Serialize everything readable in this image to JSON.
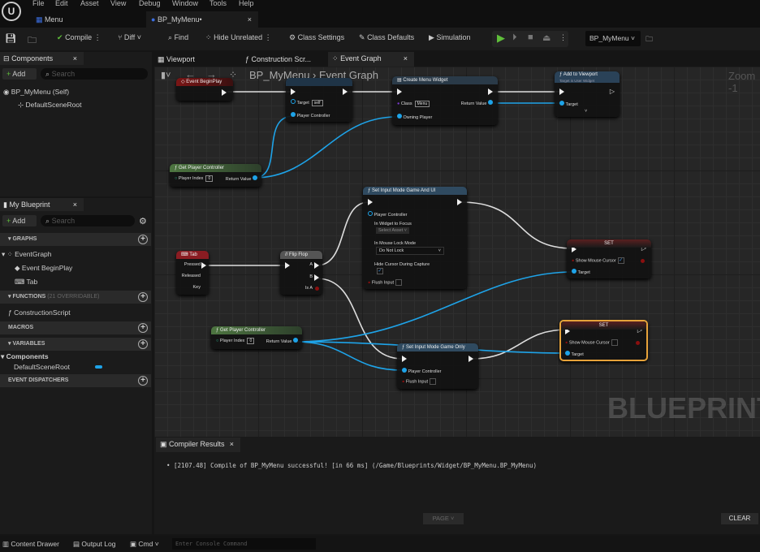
{
  "menu": [
    "File",
    "Edit",
    "Asset",
    "View",
    "Debug",
    "Window",
    "Tools",
    "Help"
  ],
  "doc_tabs": [
    {
      "label": "Menu"
    },
    {
      "label": "BP_MyMenu•",
      "active": true
    }
  ],
  "toolbar": {
    "compile": "Compile",
    "diff": "Diff",
    "find": "Find",
    "hide_unrelated": "Hide Unrelated",
    "class_settings": "Class Settings",
    "class_defaults": "Class Defaults",
    "simulation": "Simulation",
    "debug_object": "BP_MyMenu",
    "play_color": "#5fbf3a"
  },
  "components": {
    "tab": "Components",
    "add": "Add",
    "search_placeholder": "Search",
    "items": [
      "BP_MyMenu (Self)",
      "DefaultSceneRoot"
    ]
  },
  "my_blueprint": {
    "tab": "My Blueprint",
    "add": "Add",
    "search_placeholder": "Search",
    "sections": {
      "graphs": "GRAPHS",
      "functions": "FUNCTIONS",
      "functions_count": "(21 OVERRIDABLE)",
      "macros": "MACROS",
      "variables": "VARIABLES",
      "dispatchers": "EVENT DISPATCHERS"
    },
    "graph_items": [
      "EventGraph",
      "Event BeginPlay",
      "Tab"
    ],
    "function_items": [
      "ConstructionScript"
    ],
    "variable_category": "Components",
    "variable_items": [
      "DefaultSceneRoot"
    ]
  },
  "editor_tabs": [
    "Viewport",
    "Construction Scr...",
    "Event Graph"
  ],
  "breadcrumb": {
    "root": "BP_MyMenu",
    "current": "Event Graph"
  },
  "zoom": "Zoom -1",
  "watermark": "BLUEPRINT",
  "nodes": {
    "begin_play": {
      "title": "Event BeginPlay"
    },
    "set_cursor_fn": {
      "target": "Target",
      "target_value": "self",
      "player_controller": "Player Controller"
    },
    "create_widget": {
      "title": "Create Menu Widget",
      "class": "Class",
      "class_value": "Menu",
      "return_value": "Return Value",
      "owning_player": "Owning Player"
    },
    "add_viewport": {
      "title": "Add to Viewport",
      "subtitle": "Target is User Widget",
      "target": "Target"
    },
    "get_pc1": {
      "title": "Get Player Controller",
      "player_index": "Player Index",
      "index_value": "0",
      "return_value": "Return Value"
    },
    "sim_game_ui": {
      "title": "Set Input Mode Game And UI",
      "player_controller": "Player Controller",
      "widget_focus": "In Widget to Focus",
      "widget_value": "Select Asset",
      "lock_mode": "In Mouse Lock Mode",
      "lock_value": "Do Not Lock",
      "hide_cursor": "Hide Cursor During Capture",
      "hide_cursor_checked": true,
      "flush": "Flush Input"
    },
    "tab": {
      "title": "Tab",
      "pressed": "Pressed",
      "released": "Released",
      "key": "Key"
    },
    "flipflop": {
      "title": "Flip Flop",
      "a": "A",
      "b": "B",
      "is_a": "Is A"
    },
    "set1": {
      "title": "SET",
      "show_cursor": "Show Mouse Cursor",
      "checked": true,
      "target": "Target"
    },
    "get_pc2": {
      "title": "Get Player Controller",
      "player_index": "Player Index",
      "index_value": "0",
      "return_value": "Return Value"
    },
    "sim_game": {
      "title": "Set Input Mode Game Only",
      "player_controller": "Player Controller",
      "flush": "Flush Input"
    },
    "set2": {
      "title": "SET",
      "show_cursor": "Show Mouse Cursor",
      "checked": false,
      "target": "Target",
      "selected": true
    }
  },
  "compiler": {
    "tab": "Compiler Results",
    "message": "[2107.48] Compile of BP_MyMenu successful! [in 66 ms] (/Game/Blueprints/Widget/BP_MyMenu.BP_MyMenu)",
    "page": "PAGE",
    "clear": "CLEAR"
  },
  "bottom": {
    "content_drawer": "Content Drawer",
    "output_log": "Output Log",
    "cmd": "Cmd",
    "console_placeholder": "Enter Console Command"
  }
}
